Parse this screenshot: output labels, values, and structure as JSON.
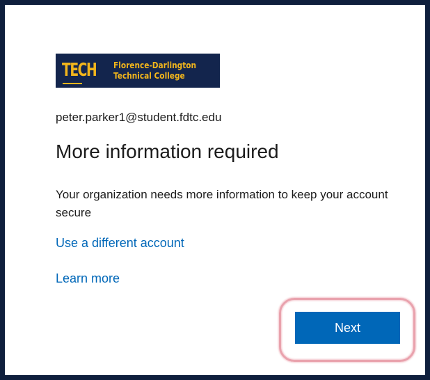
{
  "logo": {
    "mark": "TECH",
    "line1": "Florence-Darlington",
    "line2": "Technical College",
    "colors": {
      "background": "#13254d",
      "text": "#f1b51c"
    }
  },
  "account": {
    "email": "peter.parker1@student.fdtc.edu"
  },
  "page": {
    "title": "More information required",
    "description": "Your organization needs more information to keep your account secure"
  },
  "links": {
    "different_account": "Use a different account",
    "learn_more": "Learn more"
  },
  "buttons": {
    "next": "Next"
  },
  "colors": {
    "accent": "#0067b8",
    "frame": "#0f1f3d",
    "highlight": "#e9a2ad"
  }
}
